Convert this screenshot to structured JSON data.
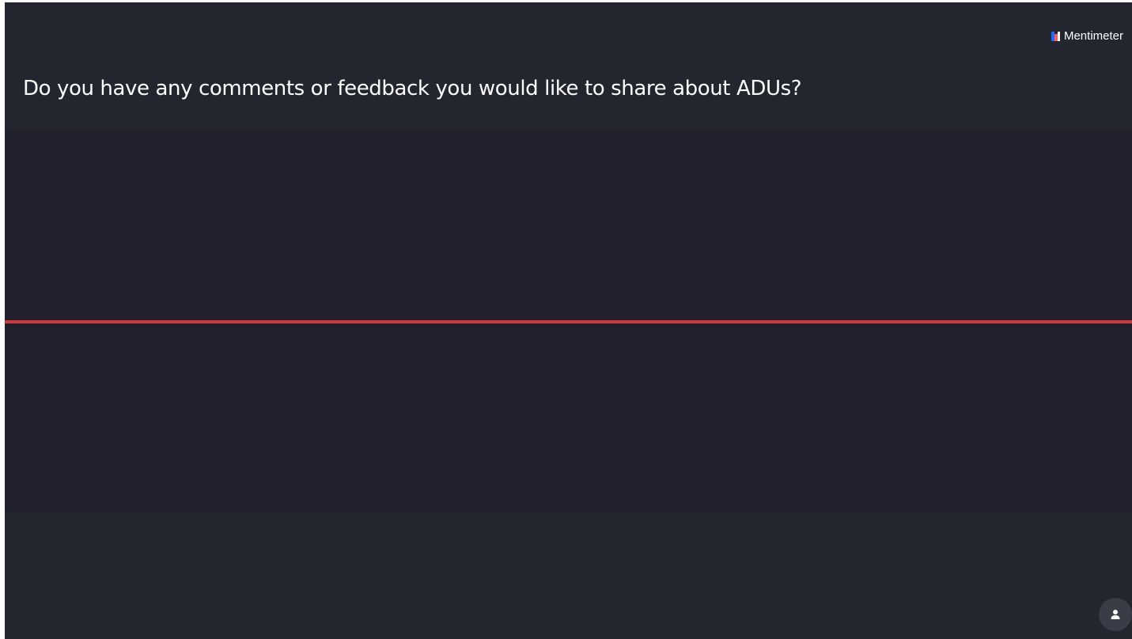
{
  "brand": {
    "name": "Mentimeter",
    "logo_colors": [
      "#196cff",
      "#ff5a5f",
      "#ffffff"
    ]
  },
  "slide": {
    "question": "Do you have any comments or feedback you would like to share about ADUs?"
  },
  "colors": {
    "background": "#23252f",
    "response_area": "#21202e",
    "divider": "#d0393c",
    "text": "#ffffff"
  },
  "controls": {
    "participant_icon": "person-icon"
  }
}
